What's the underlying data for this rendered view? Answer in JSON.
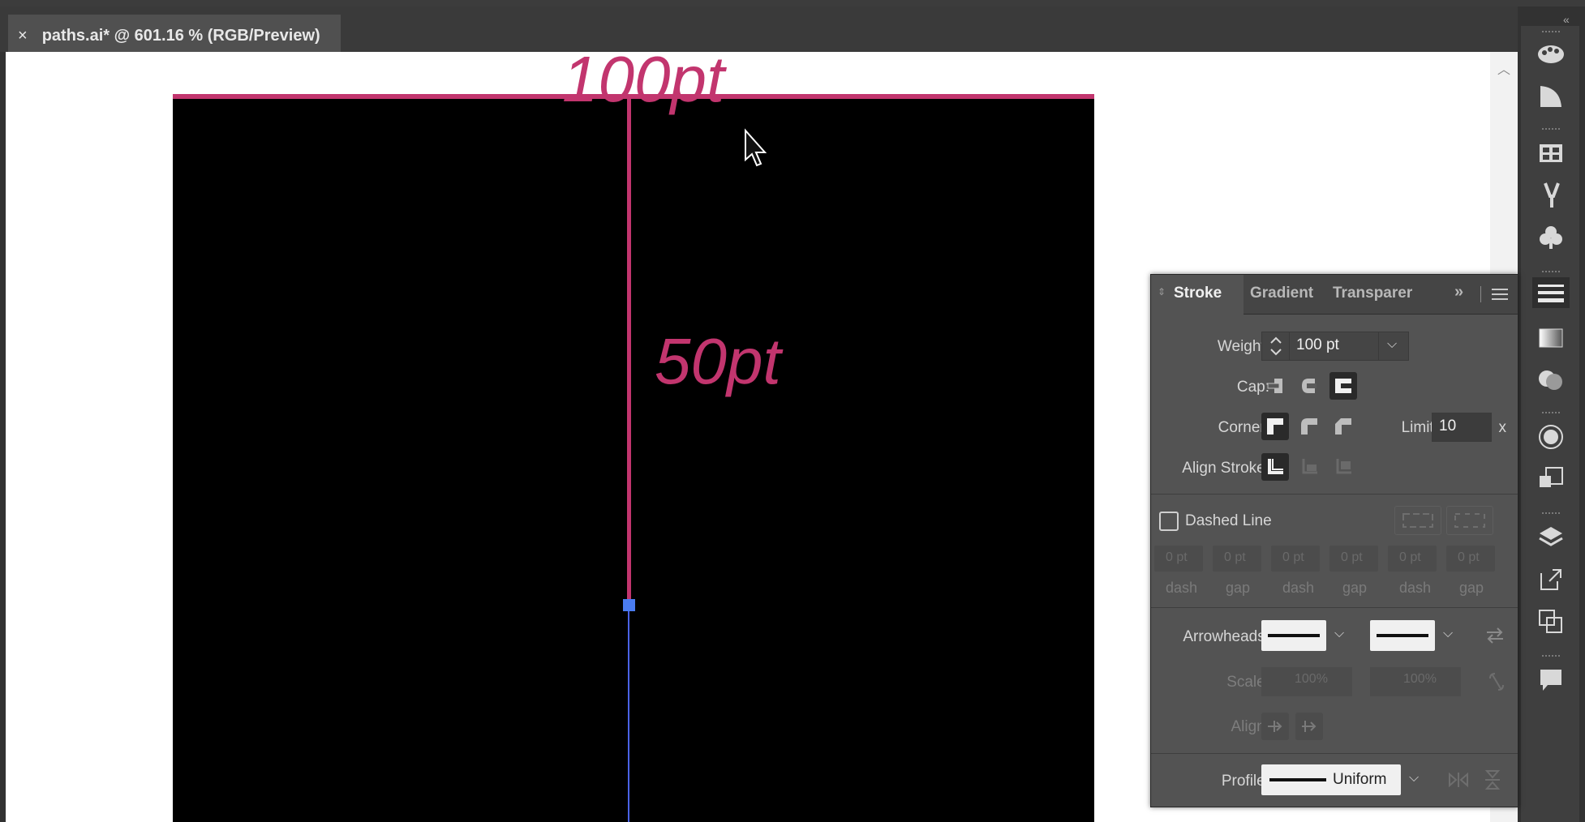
{
  "document_tab": {
    "close_glyph": "×",
    "title": "paths.ai* @ 601.16 % (RGB/Preview)"
  },
  "canvas": {
    "label_top": "100pt",
    "label_50": "50pt",
    "stroke_color": "#c2356e",
    "path_color": "#4a62e6",
    "anchor_color": "#4a7cf0"
  },
  "stroke_panel": {
    "tabs": [
      "Stroke",
      "Gradient",
      "Transparer"
    ],
    "overflow_glyph": "»",
    "weight": {
      "label": "Weight:",
      "value": "100 pt"
    },
    "cap": {
      "label": "Cap:"
    },
    "corner": {
      "label": "Corner:",
      "limit_label": "Limit:",
      "limit_value": "10",
      "limit_unit": "x"
    },
    "align_stroke": {
      "label": "Align Stroke:"
    },
    "dashed_line": {
      "label": "Dashed Line",
      "checked": false
    },
    "dash_fields": [
      {
        "value": "0 pt",
        "label": "dash"
      },
      {
        "value": "0 pt",
        "label": "gap"
      },
      {
        "value": "0 pt",
        "label": "dash"
      },
      {
        "value": "0 pt",
        "label": "gap"
      },
      {
        "value": "0 pt",
        "label": "dash"
      },
      {
        "value": "0 pt",
        "label": "gap"
      }
    ],
    "arrowheads": {
      "label": "Arrowheads:"
    },
    "scale": {
      "label": "Scale:",
      "start": "100%",
      "end": "100%"
    },
    "align": {
      "label": "Align:"
    },
    "profile": {
      "label": "Profile:",
      "value": "Uniform"
    }
  },
  "dock_icons": [
    "palette-icon",
    "swatch-wedge-icon",
    "swatch-grid-icon",
    "brush-icon",
    "symbol-club-icon",
    "stroke-lines-icon",
    "gradient-icon",
    "transparency-icon",
    "appearance-icon",
    "graphic-styles-icon",
    "layers-icon",
    "export-icon",
    "artboards-icon",
    "comments-icon"
  ]
}
